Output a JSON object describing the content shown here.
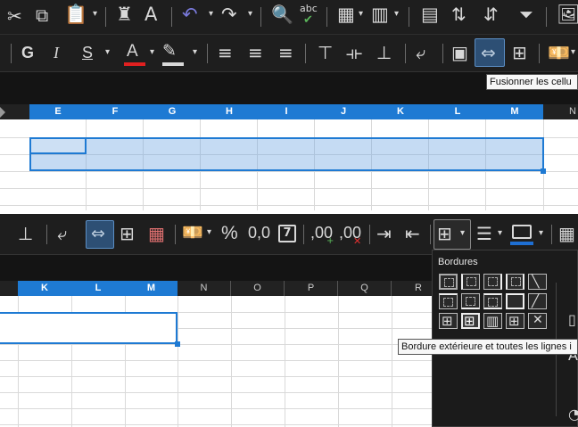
{
  "colors": {
    "toolbar_bg": "#1e1e1e",
    "header_selected": "#1e7ad3",
    "selection_fill": "#c9def4",
    "selection_border": "#1e7ad3",
    "grid_line": "#d9d9d9"
  },
  "toolbar_top": {
    "undo_icons": [
      "cut-icon",
      "copy-icon",
      "paste-icon",
      "clone-formatting-icon",
      "clear-formatting-icon",
      "undo-icon",
      "redo-icon",
      "find-replace-icon",
      "spelling-icon",
      "row-icon",
      "column-icon",
      "sort-icon",
      "sort-ascending-icon",
      "sort-descending-icon",
      "autofilter-icon",
      "image-icon"
    ],
    "bold": "G",
    "italic": "I",
    "underline": "S",
    "font_color_letter": "A",
    "spelling_label": "abc"
  },
  "tooltip_top": {
    "text": "Fusionner les cellu"
  },
  "sheet_top": {
    "columns": [
      "E",
      "F",
      "G",
      "H",
      "I",
      "J",
      "K",
      "L",
      "M",
      "N"
    ]
  },
  "toolbar_bottom": {
    "percent": "%",
    "decimal": "0,0",
    "date_day": "7",
    "add_decimal": ",00",
    "remove_decimal": ",00"
  },
  "borders_popup": {
    "title": "Bordures"
  },
  "tooltip_bottom": {
    "text": "Bordure extérieure et toutes les lignes i"
  },
  "sheet_bottom": {
    "columns": [
      "K",
      "L",
      "M",
      "N",
      "O",
      "P",
      "Q",
      "R"
    ]
  }
}
